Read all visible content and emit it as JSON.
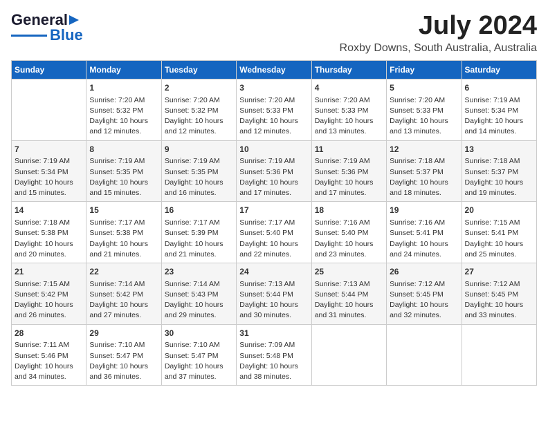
{
  "header": {
    "logo_line1": "General",
    "logo_line2": "Blue",
    "month": "July 2024",
    "location": "Roxby Downs, South Australia, Australia"
  },
  "days_of_week": [
    "Sunday",
    "Monday",
    "Tuesday",
    "Wednesday",
    "Thursday",
    "Friday",
    "Saturday"
  ],
  "weeks": [
    [
      {
        "day": "",
        "content": ""
      },
      {
        "day": "1",
        "content": "Sunrise: 7:20 AM\nSunset: 5:32 PM\nDaylight: 10 hours\nand 12 minutes."
      },
      {
        "day": "2",
        "content": "Sunrise: 7:20 AM\nSunset: 5:32 PM\nDaylight: 10 hours\nand 12 minutes."
      },
      {
        "day": "3",
        "content": "Sunrise: 7:20 AM\nSunset: 5:33 PM\nDaylight: 10 hours\nand 12 minutes."
      },
      {
        "day": "4",
        "content": "Sunrise: 7:20 AM\nSunset: 5:33 PM\nDaylight: 10 hours\nand 13 minutes."
      },
      {
        "day": "5",
        "content": "Sunrise: 7:20 AM\nSunset: 5:33 PM\nDaylight: 10 hours\nand 13 minutes."
      },
      {
        "day": "6",
        "content": "Sunrise: 7:19 AM\nSunset: 5:34 PM\nDaylight: 10 hours\nand 14 minutes."
      }
    ],
    [
      {
        "day": "7",
        "content": "Sunrise: 7:19 AM\nSunset: 5:34 PM\nDaylight: 10 hours\nand 15 minutes."
      },
      {
        "day": "8",
        "content": "Sunrise: 7:19 AM\nSunset: 5:35 PM\nDaylight: 10 hours\nand 15 minutes."
      },
      {
        "day": "9",
        "content": "Sunrise: 7:19 AM\nSunset: 5:35 PM\nDaylight: 10 hours\nand 16 minutes."
      },
      {
        "day": "10",
        "content": "Sunrise: 7:19 AM\nSunset: 5:36 PM\nDaylight: 10 hours\nand 17 minutes."
      },
      {
        "day": "11",
        "content": "Sunrise: 7:19 AM\nSunset: 5:36 PM\nDaylight: 10 hours\nand 17 minutes."
      },
      {
        "day": "12",
        "content": "Sunrise: 7:18 AM\nSunset: 5:37 PM\nDaylight: 10 hours\nand 18 minutes."
      },
      {
        "day": "13",
        "content": "Sunrise: 7:18 AM\nSunset: 5:37 PM\nDaylight: 10 hours\nand 19 minutes."
      }
    ],
    [
      {
        "day": "14",
        "content": "Sunrise: 7:18 AM\nSunset: 5:38 PM\nDaylight: 10 hours\nand 20 minutes."
      },
      {
        "day": "15",
        "content": "Sunrise: 7:17 AM\nSunset: 5:38 PM\nDaylight: 10 hours\nand 21 minutes."
      },
      {
        "day": "16",
        "content": "Sunrise: 7:17 AM\nSunset: 5:39 PM\nDaylight: 10 hours\nand 21 minutes."
      },
      {
        "day": "17",
        "content": "Sunrise: 7:17 AM\nSunset: 5:40 PM\nDaylight: 10 hours\nand 22 minutes."
      },
      {
        "day": "18",
        "content": "Sunrise: 7:16 AM\nSunset: 5:40 PM\nDaylight: 10 hours\nand 23 minutes."
      },
      {
        "day": "19",
        "content": "Sunrise: 7:16 AM\nSunset: 5:41 PM\nDaylight: 10 hours\nand 24 minutes."
      },
      {
        "day": "20",
        "content": "Sunrise: 7:15 AM\nSunset: 5:41 PM\nDaylight: 10 hours\nand 25 minutes."
      }
    ],
    [
      {
        "day": "21",
        "content": "Sunrise: 7:15 AM\nSunset: 5:42 PM\nDaylight: 10 hours\nand 26 minutes."
      },
      {
        "day": "22",
        "content": "Sunrise: 7:14 AM\nSunset: 5:42 PM\nDaylight: 10 hours\nand 27 minutes."
      },
      {
        "day": "23",
        "content": "Sunrise: 7:14 AM\nSunset: 5:43 PM\nDaylight: 10 hours\nand 29 minutes."
      },
      {
        "day": "24",
        "content": "Sunrise: 7:13 AM\nSunset: 5:44 PM\nDaylight: 10 hours\nand 30 minutes."
      },
      {
        "day": "25",
        "content": "Sunrise: 7:13 AM\nSunset: 5:44 PM\nDaylight: 10 hours\nand 31 minutes."
      },
      {
        "day": "26",
        "content": "Sunrise: 7:12 AM\nSunset: 5:45 PM\nDaylight: 10 hours\nand 32 minutes."
      },
      {
        "day": "27",
        "content": "Sunrise: 7:12 AM\nSunset: 5:45 PM\nDaylight: 10 hours\nand 33 minutes."
      }
    ],
    [
      {
        "day": "28",
        "content": "Sunrise: 7:11 AM\nSunset: 5:46 PM\nDaylight: 10 hours\nand 34 minutes."
      },
      {
        "day": "29",
        "content": "Sunrise: 7:10 AM\nSunset: 5:47 PM\nDaylight: 10 hours\nand 36 minutes."
      },
      {
        "day": "30",
        "content": "Sunrise: 7:10 AM\nSunset: 5:47 PM\nDaylight: 10 hours\nand 37 minutes."
      },
      {
        "day": "31",
        "content": "Sunrise: 7:09 AM\nSunset: 5:48 PM\nDaylight: 10 hours\nand 38 minutes."
      },
      {
        "day": "",
        "content": ""
      },
      {
        "day": "",
        "content": ""
      },
      {
        "day": "",
        "content": ""
      }
    ]
  ]
}
